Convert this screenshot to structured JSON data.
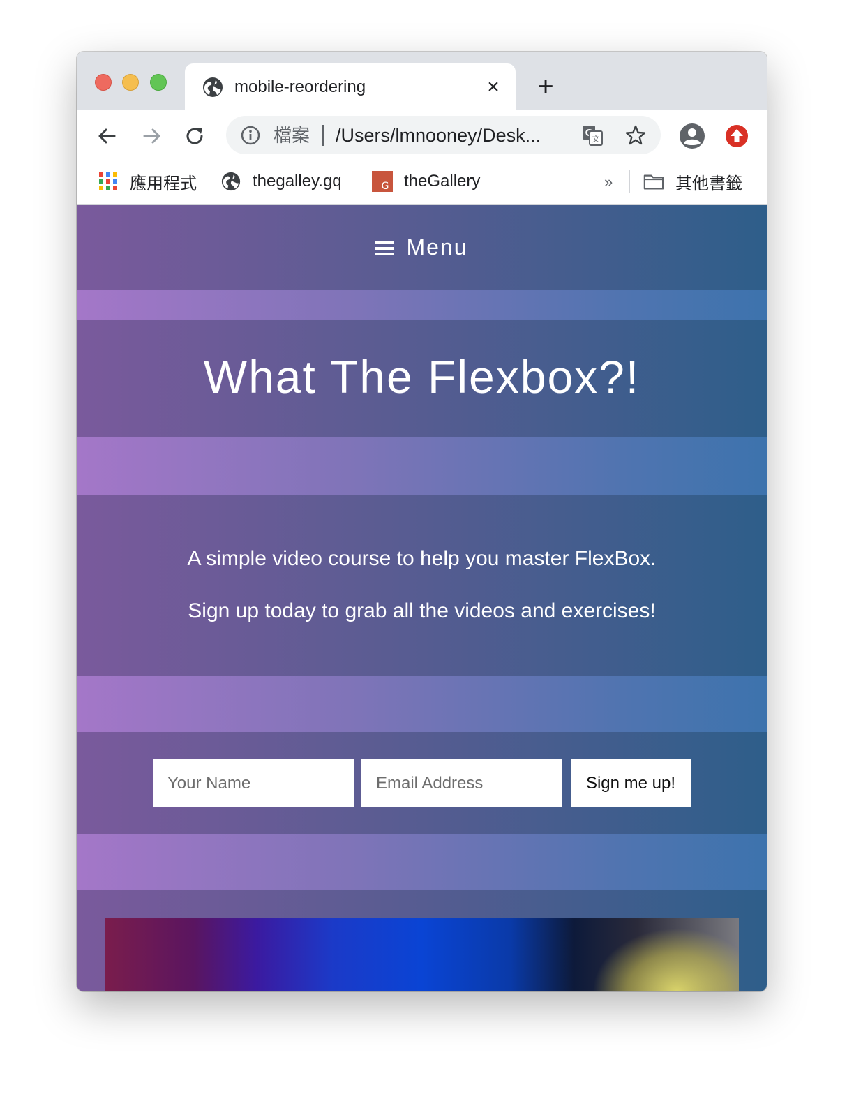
{
  "browser": {
    "tab": {
      "title": "mobile-reordering",
      "close_glyph": "×"
    },
    "new_tab_glyph": "+",
    "omnibox": {
      "scheme_label": "檔案",
      "url": "/Users/lmnooney/Desk..."
    },
    "bookmarks": [
      {
        "label": "應用程式",
        "icon": "apps-grid-icon"
      },
      {
        "label": "thegalley.gq",
        "icon": "globe-icon"
      },
      {
        "label": "theGallery",
        "icon": "gallery-favicon-icon"
      }
    ],
    "overflow_glyph": "»",
    "other_bookmarks": "其他書籤"
  },
  "page": {
    "menu_label": "Menu",
    "hero_title": "What The Flexbox?!",
    "lead_line_1": "A simple video course to help you master FlexBox.",
    "lead_line_2": "Sign up today to grab all the videos and exercises!",
    "form": {
      "name_placeholder": "Your Name",
      "email_placeholder": "Email Address",
      "submit_label": "Sign me up!"
    }
  },
  "colors": {
    "traffic_red": "#ee6a5f",
    "traffic_yellow": "#f5be4f",
    "traffic_green": "#62c555",
    "page_gradient_start": "#7a5a9c",
    "page_gradient_end": "#2e5e8a",
    "band_gradient_start": "#a477c8",
    "band_gradient_end": "#3d73ad"
  }
}
